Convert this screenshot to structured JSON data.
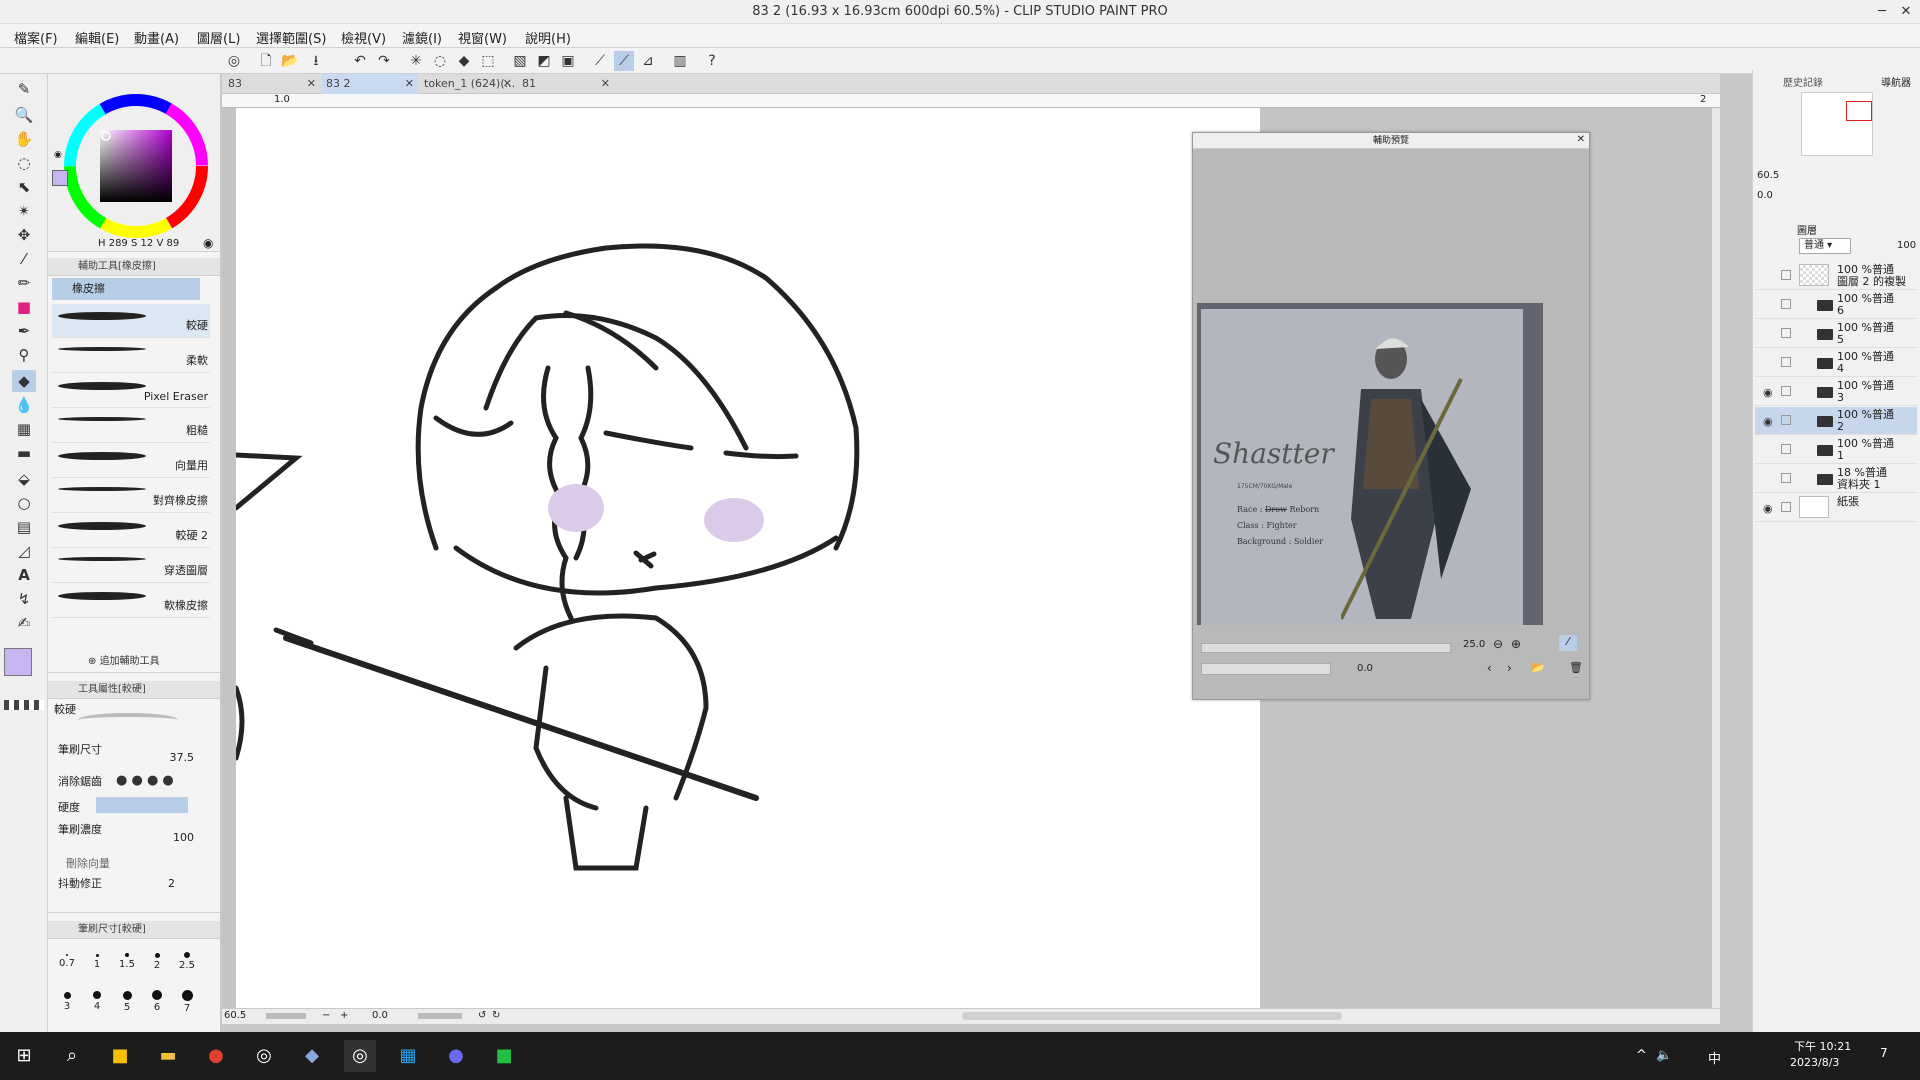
{
  "window": {
    "title": "83 2 (16.93 x 16.93cm 600dpi 60.5%) - CLIP STUDIO PAINT PRO",
    "minimize": "─",
    "maximize": "□",
    "close": "✕"
  },
  "menu": [
    "檔案(F)",
    "編輯(E)",
    "動畫(A)",
    "圖層(L)",
    "選擇範圍(S)",
    "檢視(V)",
    "濾鏡(I)",
    "視窗(W)",
    "說明(H)"
  ],
  "tabs": [
    {
      "label": "83"
    },
    {
      "label": "83 2",
      "active": true
    },
    {
      "label": "token_1 (624)(..."
    },
    {
      "label": "81"
    }
  ],
  "ruler": {
    "start": "1.0",
    "end": "2"
  },
  "color_panel": {
    "readout": "289",
    "readout2": "12",
    "readout3": "89",
    "main_color": "#c8b4f0",
    "sub_color": "#2a2a2a"
  },
  "subtool_panel": {
    "header": "輔助工具[橡皮擦]",
    "group": "橡皮擦",
    "brushes": [
      "較硬",
      "柔軟",
      "Pixel Eraser",
      "粗糙",
      "向量用",
      "對齊橡皮擦",
      "較硬 2",
      "穿透圖層",
      "軟橡皮擦"
    ],
    "add_label": "追加輔助工具"
  },
  "tool_property": {
    "header": "工具屬性[較硬]",
    "preview_name": "較硬",
    "brush_size_label": "筆刷尺寸",
    "brush_size_value": "37.5",
    "antialias_label": "消除鋸齒",
    "hardness_label": "硬度",
    "density_label": "筆刷濃度",
    "density_value": "100",
    "delete_vector_label": "刪除向量",
    "stabilization_label": "抖動修正",
    "stabilization_value": "2"
  },
  "brush_size_panel": {
    "header": "筆刷尺寸[較硬]",
    "sizes": [
      "0.7",
      "1",
      "1.5",
      "2",
      "2.5",
      "3",
      "4",
      "5",
      "6",
      "7"
    ]
  },
  "status": {
    "zoom": "60.5",
    "rotation": "0.0"
  },
  "preview_window": {
    "title": "輔助預覽",
    "zoom": "25.0",
    "rotation": "0.0",
    "ref_name": "Shastter",
    "ref_sub": "175CM/70KG/Male",
    "ref_race_label": "Race :",
    "ref_race_strike": "Drow",
    "ref_race": "Reborn",
    "ref_class": "Class : Fighter",
    "ref_bg": "Background : Soldier"
  },
  "right_panel": {
    "history_label": "歷史記錄",
    "navigator_label": "導航器",
    "nav_zoom": "60.5",
    "nav_rotation": "0.0",
    "layer_tab": "圖層",
    "blend_mode": "普通",
    "opacity": "100",
    "layers": [
      {
        "top": "100 %普通",
        "name": "圖層 2 的複製",
        "folder": false,
        "visible": false
      },
      {
        "top": "100 %普通",
        "name": "6",
        "folder": true,
        "visible": false
      },
      {
        "top": "100 %普通",
        "name": "5",
        "folder": true,
        "visible": false
      },
      {
        "top": "100 %普通",
        "name": "4",
        "folder": true,
        "visible": false
      },
      {
        "top": "100 %普通",
        "name": "3",
        "folder": true,
        "visible": true
      },
      {
        "top": "100 %普通",
        "name": "2",
        "folder": true,
        "visible": true,
        "selected": true
      },
      {
        "top": "100 %普通",
        "name": "1",
        "folder": true,
        "visible": false
      },
      {
        "top": "18 %普通",
        "name": "資料夾 1",
        "folder": true,
        "visible": false
      },
      {
        "top": "",
        "name": "紙張",
        "folder": false,
        "visible": true
      }
    ]
  },
  "taskbar": {
    "time": "下午 10:21",
    "date": "2023/8/3",
    "ime": "中",
    "notifications": "7"
  }
}
